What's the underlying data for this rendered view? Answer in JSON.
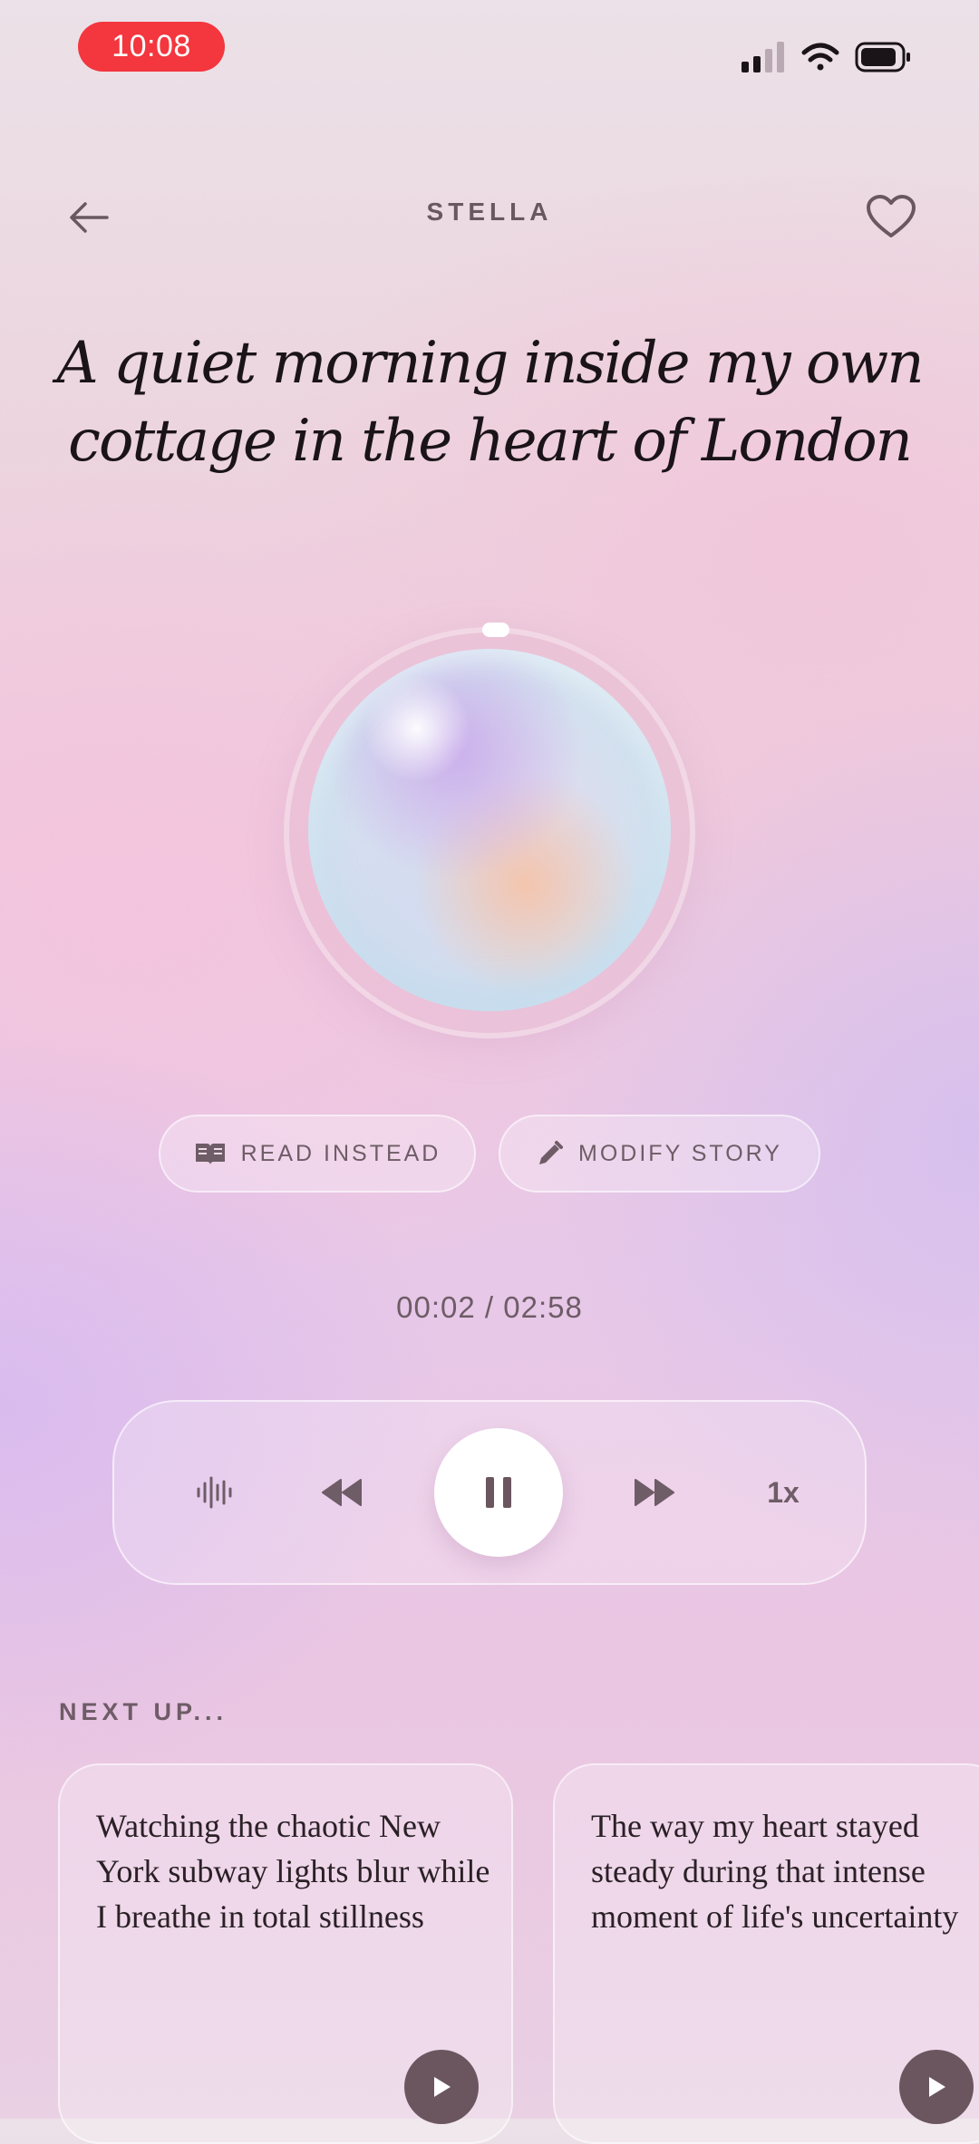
{
  "status_bar": {
    "time": "10:08"
  },
  "header": {
    "title": "STELLA"
  },
  "story": {
    "title": "A quiet morning inside my own cottage in the heart of London"
  },
  "actions": {
    "read_label": "READ INSTEAD",
    "modify_label": "MODIFY STORY"
  },
  "player": {
    "time_display": "00:02 / 02:58",
    "progress_fraction": 0.011,
    "speed_label": "1x"
  },
  "next_up": {
    "label": "NEXT UP...",
    "items": [
      {
        "text": "Watching the chaotic New York subway lights blur while I breathe in total stillness"
      },
      {
        "text": "The way my heart stayed steady during that intense moment of life's uncertainty"
      }
    ]
  },
  "colors": {
    "accent": "#6b5660",
    "time_pill": "#f4363e"
  },
  "icons": [
    "back-arrow-icon",
    "heart-icon",
    "book-icon",
    "pencil-icon",
    "waveform-icon",
    "rewind-icon",
    "pause-icon",
    "fast-forward-icon",
    "play-icon"
  ]
}
